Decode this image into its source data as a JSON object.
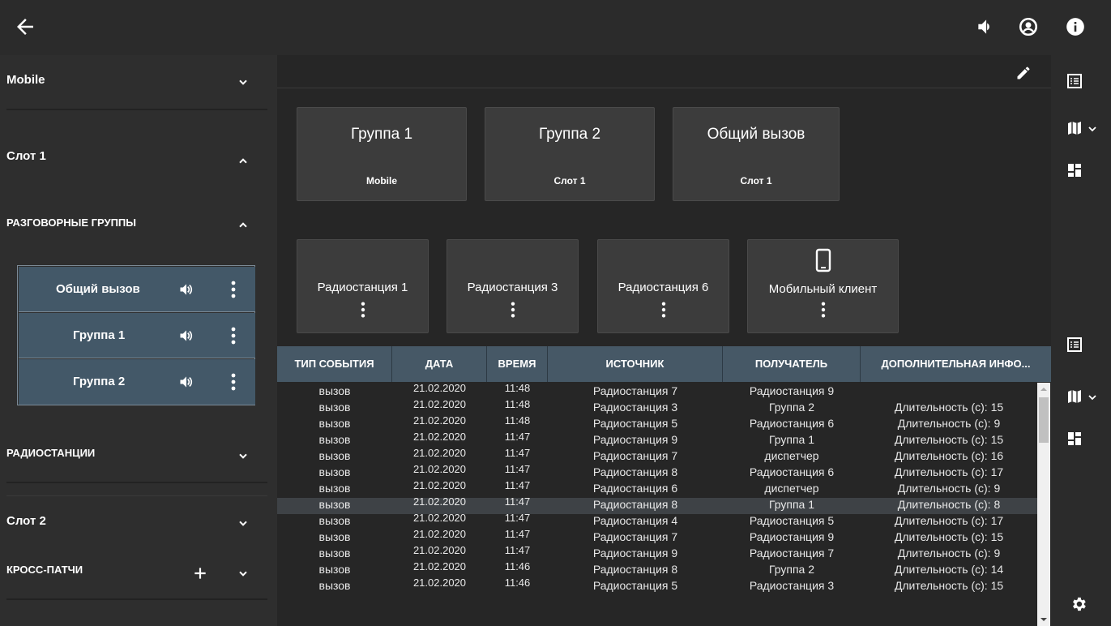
{
  "sidebar": {
    "mobile_label": "Mobile",
    "slot1_label": "Слот 1",
    "talkgroups_label": "РАЗГОВОРНЫЕ ГРУППЫ",
    "groups": [
      {
        "name": "Общий вызов"
      },
      {
        "name": "Группа 1"
      },
      {
        "name": "Группа 2"
      }
    ],
    "radios_label": "РАДИОСТАНЦИИ",
    "slot2_label": "Слот 2",
    "crosspatch_label": "КРОСС-ПАТЧИ"
  },
  "tiles": [
    {
      "title": "Группа 1",
      "subtitle": "Mobile"
    },
    {
      "title": "Группа 2",
      "subtitle": "Слот 1"
    },
    {
      "title": "Общий вызов",
      "subtitle": "Слот 1"
    }
  ],
  "stations": [
    {
      "name": "Радиостанция 1"
    },
    {
      "name": "Радиостанция 3"
    },
    {
      "name": "Радиостанция 6"
    },
    {
      "name": "Мобильный клиент"
    }
  ],
  "table": {
    "columns": [
      "ТИП СОБЫТИЯ",
      "ДАТА",
      "ВРЕМЯ",
      "ИСТОЧНИК",
      "ПОЛУЧАТЕЛЬ",
      "ДОПОЛНИТЕЛЬНАЯ ИНФО..."
    ],
    "rows": [
      {
        "type": "вызов",
        "date": "21.02.2020",
        "time": "11:48",
        "source": "Радиостанция 7",
        "target": "Радиостанция 9",
        "info": ""
      },
      {
        "type": "вызов",
        "date": "21.02.2020",
        "time": "11:48",
        "source": "Радиостанция 3",
        "target": "Группа 2",
        "info": "Длительность (с): 15"
      },
      {
        "type": "вызов",
        "date": "21.02.2020",
        "time": "11:48",
        "source": "Радиостанция 5",
        "target": "Радиостанция 6",
        "info": "Длительность (с): 9"
      },
      {
        "type": "вызов",
        "date": "21.02.2020",
        "time": "11:47",
        "source": "Радиостанция 9",
        "target": "Группа 1",
        "info": "Длительность (с): 15"
      },
      {
        "type": "вызов",
        "date": "21.02.2020",
        "time": "11:47",
        "source": "Радиостанция 7",
        "target": "диспетчер",
        "info": "Длительность (с): 16"
      },
      {
        "type": "вызов",
        "date": "21.02.2020",
        "time": "11:47",
        "source": "Радиостанция 8",
        "target": "Радиостанция 6",
        "info": "Длительность (с): 17"
      },
      {
        "type": "вызов",
        "date": "21.02.2020",
        "time": "11:47",
        "source": "Радиостанция 6",
        "target": "диспетчер",
        "info": "Длительность (с): 9"
      },
      {
        "type": "вызов",
        "date": "21.02.2020",
        "time": "11:47",
        "source": "Радиостанция 8",
        "target": "Группа 1",
        "info": "Длительность (с): 8"
      },
      {
        "type": "вызов",
        "date": "21.02.2020",
        "time": "11:47",
        "source": "Радиостанция 4",
        "target": "Радиостанция 5",
        "info": "Длительность (с): 17"
      },
      {
        "type": "вызов",
        "date": "21.02.2020",
        "time": "11:47",
        "source": "Радиостанция 7",
        "target": "Радиостанция 9",
        "info": "Длительность (с): 15"
      },
      {
        "type": "вызов",
        "date": "21.02.2020",
        "time": "11:47",
        "source": "Радиостанция 9",
        "target": "Радиостанция 7",
        "info": "Длительность (с): 9"
      },
      {
        "type": "вызов",
        "date": "21.02.2020",
        "time": "11:46",
        "source": "Радиостанция 8",
        "target": "Группа 2",
        "info": "Длительность (с): 14"
      },
      {
        "type": "вызов",
        "date": "21.02.2020",
        "time": "11:46",
        "source": "Радиостанция 5",
        "target": "Радиостанция 3",
        "info": "Длительность (с): 15"
      }
    ]
  },
  "icons": {
    "back": "arrow-left-icon",
    "volume": "speaker-icon",
    "account": "account-circle-icon",
    "info": "info-icon",
    "edit": "pencil-icon",
    "list": "list-view-icon",
    "map": "map-icon",
    "dashboard": "dashboard-icon",
    "settings": "gear-icon",
    "phone": "mobile-phone-icon"
  },
  "colors": {
    "accent": "#465866",
    "group_row": "#435868",
    "selected_row": "#3e4246",
    "tile": "#3c3c3c"
  }
}
